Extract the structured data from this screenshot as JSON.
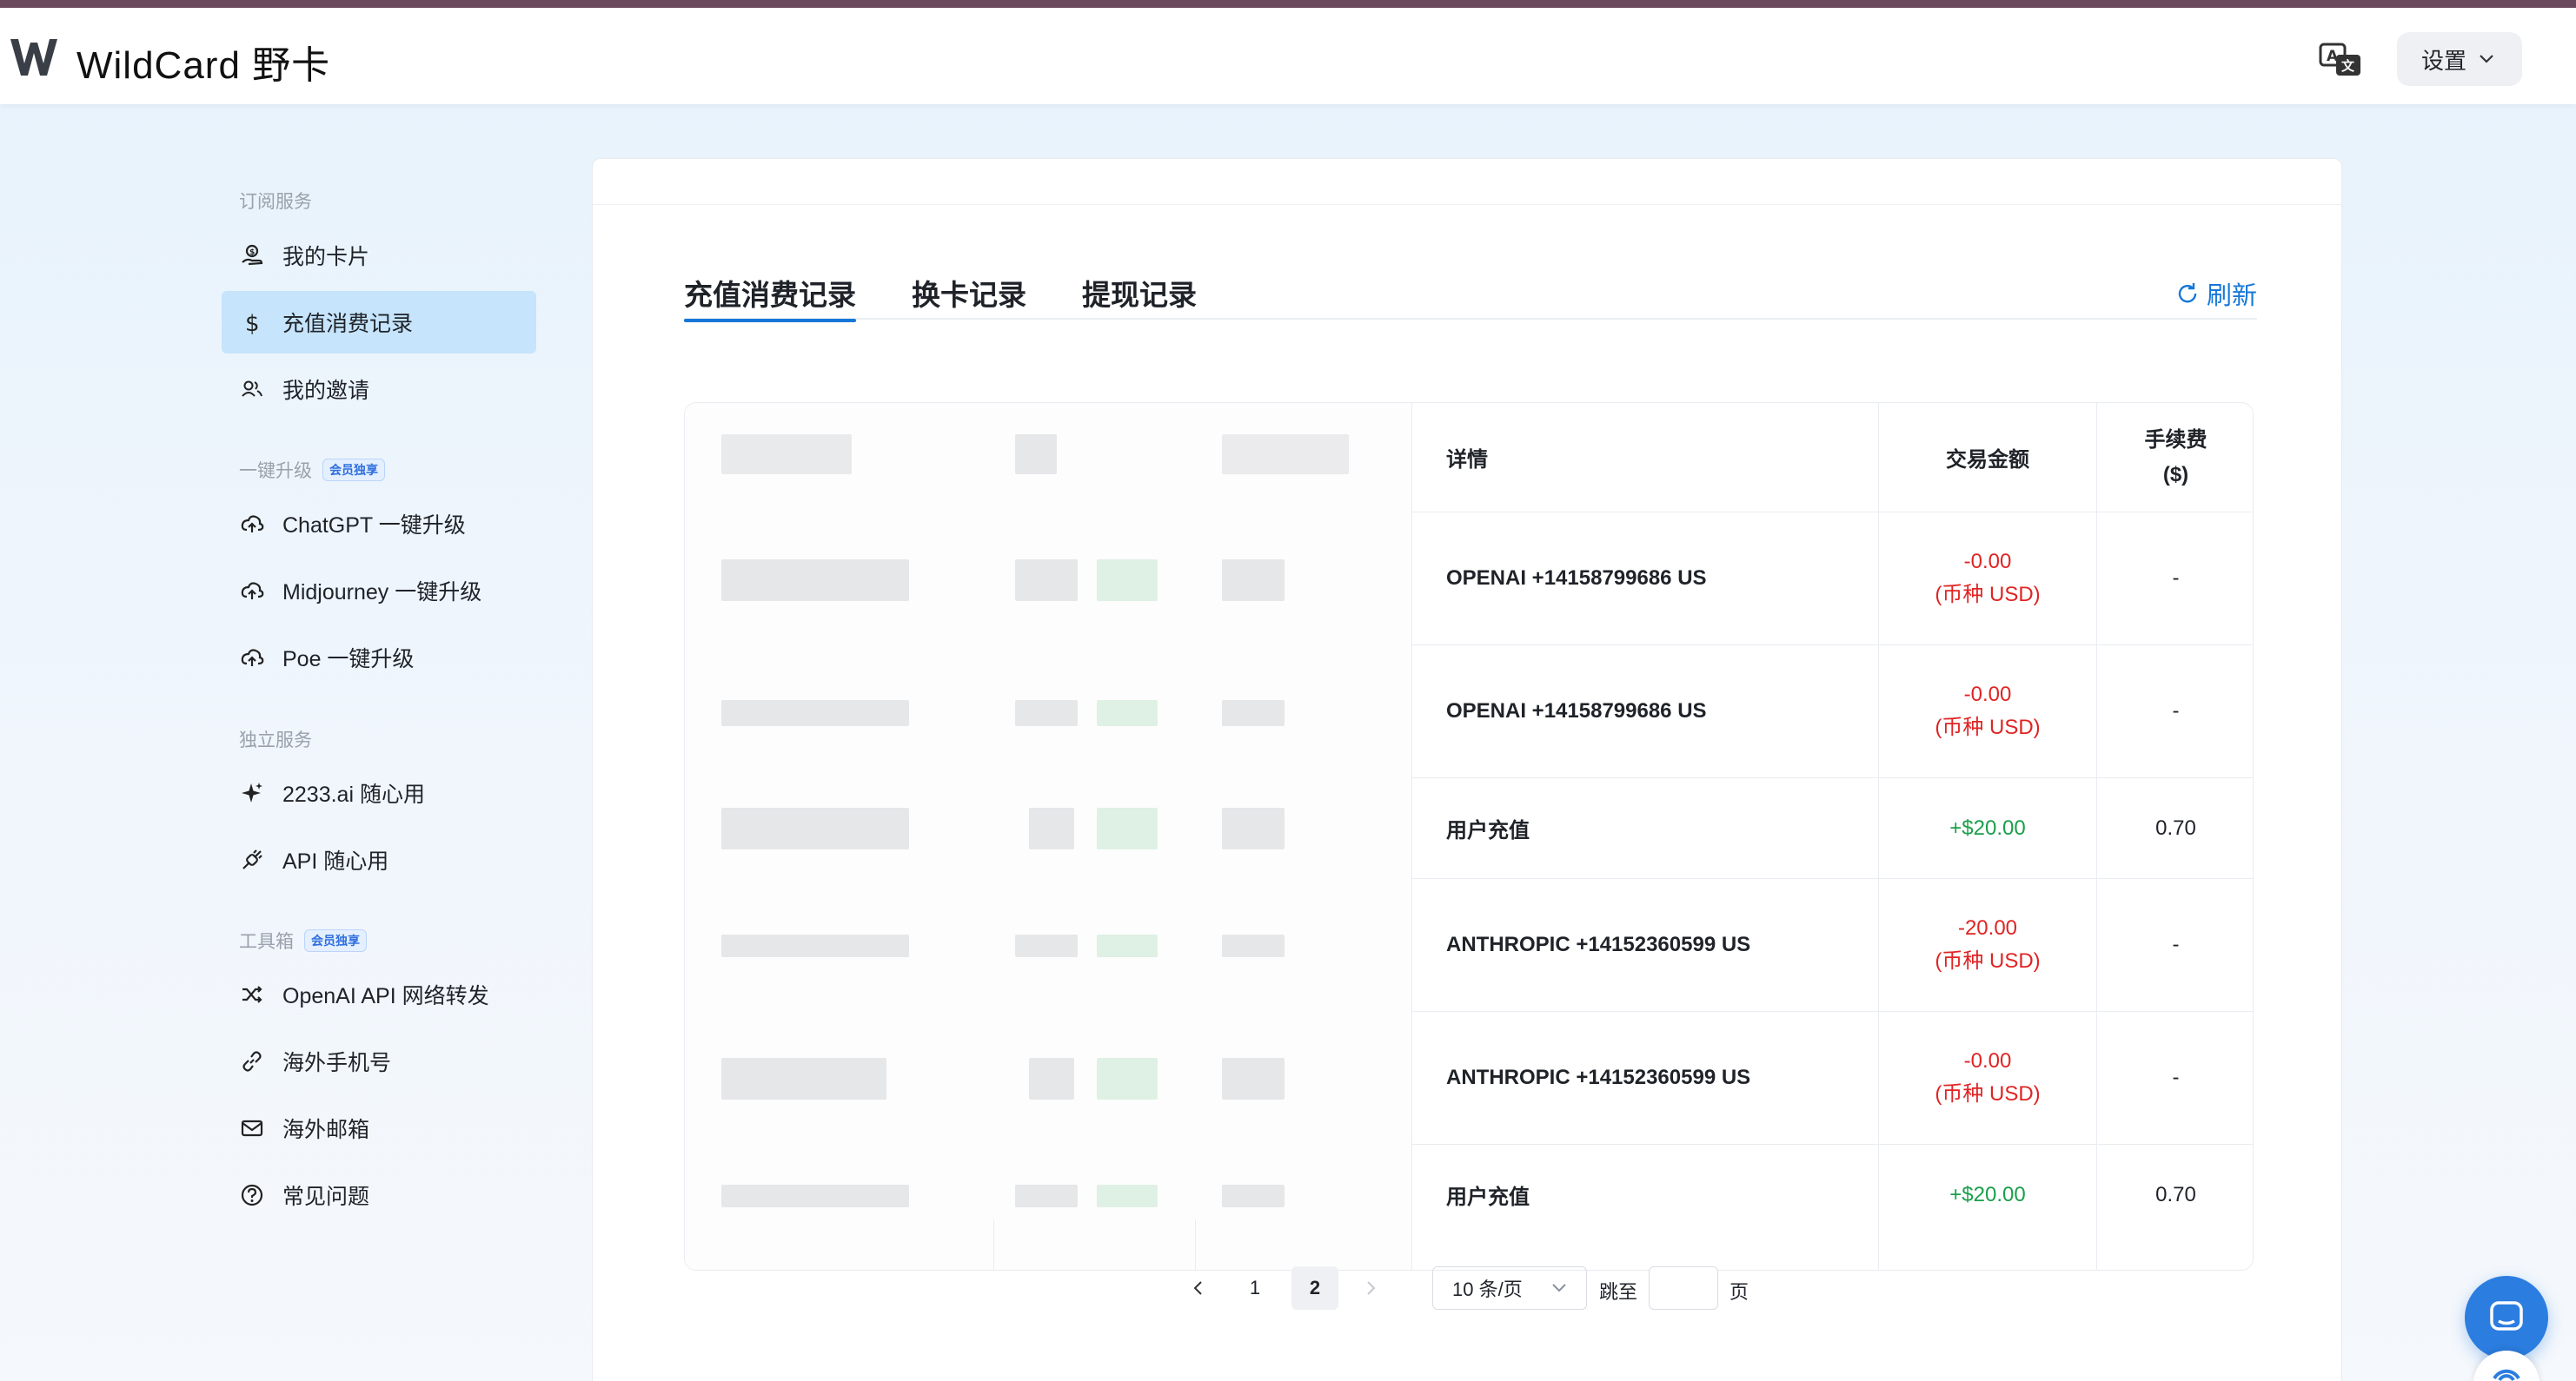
{
  "app": {
    "logo_text": "WildCard 野卡",
    "settings_label": "设置",
    "lang_icon": "translate-icon"
  },
  "sidebar": {
    "sections": [
      {
        "title": "订阅服务",
        "badge": ""
      },
      {
        "title": "一键升级",
        "badge": "会员独享"
      },
      {
        "title": "独立服务",
        "badge": ""
      },
      {
        "title": "工具箱",
        "badge": "会员独享"
      }
    ],
    "items": [
      {
        "label": "我的卡片",
        "icon": "card-hand-icon"
      },
      {
        "label": "充值消费记录",
        "icon": "dollar-icon"
      },
      {
        "label": "我的邀请",
        "icon": "users-icon"
      },
      {
        "label": "ChatGPT 一键升级",
        "icon": "cloud-upload-icon"
      },
      {
        "label": "Midjourney 一键升级",
        "icon": "cloud-upload-icon"
      },
      {
        "label": "Poe 一键升级",
        "icon": "cloud-upload-icon"
      },
      {
        "label": "2233.ai 随心用",
        "icon": "sparkle-icon"
      },
      {
        "label": "API 随心用",
        "icon": "plug-icon"
      },
      {
        "label": "OpenAI API 网络转发",
        "icon": "shuffle-icon"
      },
      {
        "label": "海外手机号",
        "icon": "link-icon"
      },
      {
        "label": "海外邮箱",
        "icon": "mail-icon"
      },
      {
        "label": "常见问题",
        "icon": "question-icon"
      }
    ]
  },
  "main": {
    "tabs": [
      "充值消费记录",
      "换卡记录",
      "提现记录"
    ],
    "refresh_label": "刷新",
    "table": {
      "headers": {
        "detail": "详情",
        "amount": "交易金额",
        "fee_line1": "手续费",
        "fee_line2": "($)"
      },
      "rows": [
        {
          "detail": "OPENAI +14158799686 US",
          "amount": "-0.00",
          "currency": "(币种 USD)",
          "fee": "-"
        },
        {
          "detail": "OPENAI +14158799686 US",
          "amount": "-0.00",
          "currency": "(币种 USD)",
          "fee": "-"
        },
        {
          "detail": "用户充值",
          "amount": "+$20.00",
          "currency": "",
          "fee": "0.70"
        },
        {
          "detail": "ANTHROPIC +14152360599 US",
          "amount": "-20.00",
          "currency": "(币种 USD)",
          "fee": "-"
        },
        {
          "detail": "ANTHROPIC +14152360599 US",
          "amount": "-0.00",
          "currency": "(币种 USD)",
          "fee": "-"
        },
        {
          "detail": "用户充值",
          "amount": "+$20.00",
          "currency": "",
          "fee": "0.70"
        }
      ]
    },
    "pagination": {
      "pages": [
        "1",
        "2"
      ],
      "current": "2",
      "page_size": "10 条/页",
      "jump_label": "跳至",
      "page_suffix": "页"
    }
  },
  "colors": {
    "accent": "#1677d8",
    "negative": "#e02424",
    "positive": "#1a9f4a",
    "active_nav": "#c6e4fb"
  }
}
